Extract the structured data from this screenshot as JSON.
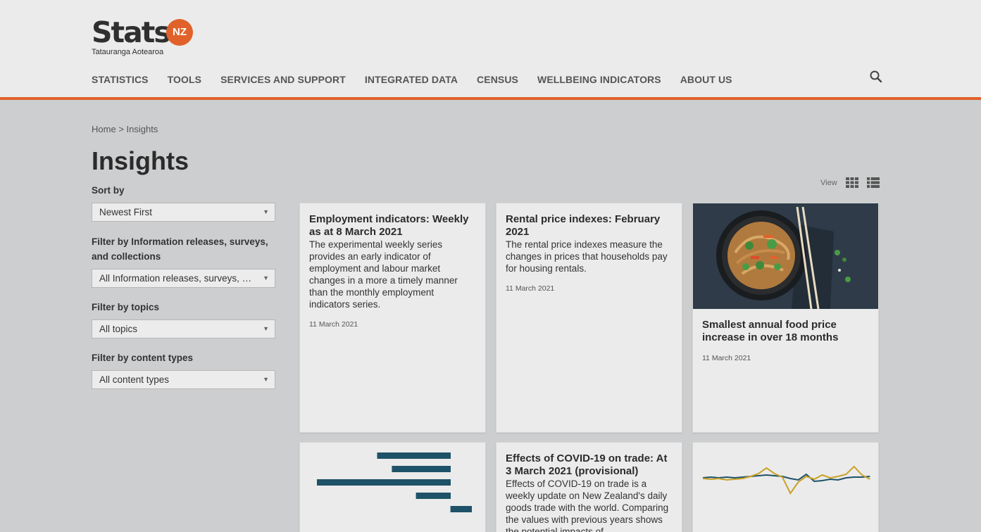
{
  "brand": {
    "wordmark": "Stats",
    "badge": "NZ",
    "tagline": "Tatauranga Aotearoa",
    "accent_color": "#e0622a"
  },
  "nav": {
    "items": [
      "STATISTICS",
      "TOOLS",
      "SERVICES AND SUPPORT",
      "INTEGRATED DATA",
      "CENSUS",
      "WELLBEING INDICATORS",
      "ABOUT US"
    ],
    "search_icon": "search-icon"
  },
  "breadcrumb": {
    "home": "Home",
    "separator": ">",
    "current": "Insights"
  },
  "page": {
    "title": "Insights"
  },
  "filters": {
    "sort_label": "Sort by",
    "sort_value": "Newest First",
    "releases_label": "Filter by Information releases, surveys, and collections",
    "releases_value": "All Information releases, surveys, a...",
    "topics_label": "Filter by topics",
    "topics_value": "All topics",
    "content_label": "Filter by content types",
    "content_value": "All content types"
  },
  "view": {
    "label": "View",
    "grid_icon": "grid-view-icon",
    "list_icon": "list-view-icon"
  },
  "cards": [
    {
      "title": "Employment indicators: Weekly as at 8 March 2021",
      "description": "The experimental weekly series provides an early indicator of employment and labour market changes in a more a timely manner than the monthly employment indicators series.",
      "date": "11 March 2021"
    },
    {
      "title": "Rental price indexes: February 2021",
      "description": "The rental price indexes measure the changes in prices that households pay for housing rentals.",
      "date": "11 March 2021"
    },
    {
      "title": "Smallest annual food price increase in over 18 months",
      "date": "11 March 2021",
      "image": "noodle-bowl-image"
    },
    {
      "image": "horizontal-bar-chart-thumbnail"
    },
    {
      "title": "Effects of COVID-19 on trade: At 3 March 2021 (provisional)",
      "description": "Effects of COVID-19 on trade is a weekly update on New Zealand's daily goods trade with the world. Comparing the values with previous years shows the potential impacts of"
    },
    {
      "image": "line-chart-thumbnail"
    }
  ],
  "thumbnail_bars": {
    "color": "#1e5268",
    "values": [
      0.55,
      0.44,
      1.0,
      0.26,
      0.16
    ]
  },
  "thumbnail_lines": {
    "series_colors": [
      "#1e5268",
      "#c9a227"
    ]
  }
}
